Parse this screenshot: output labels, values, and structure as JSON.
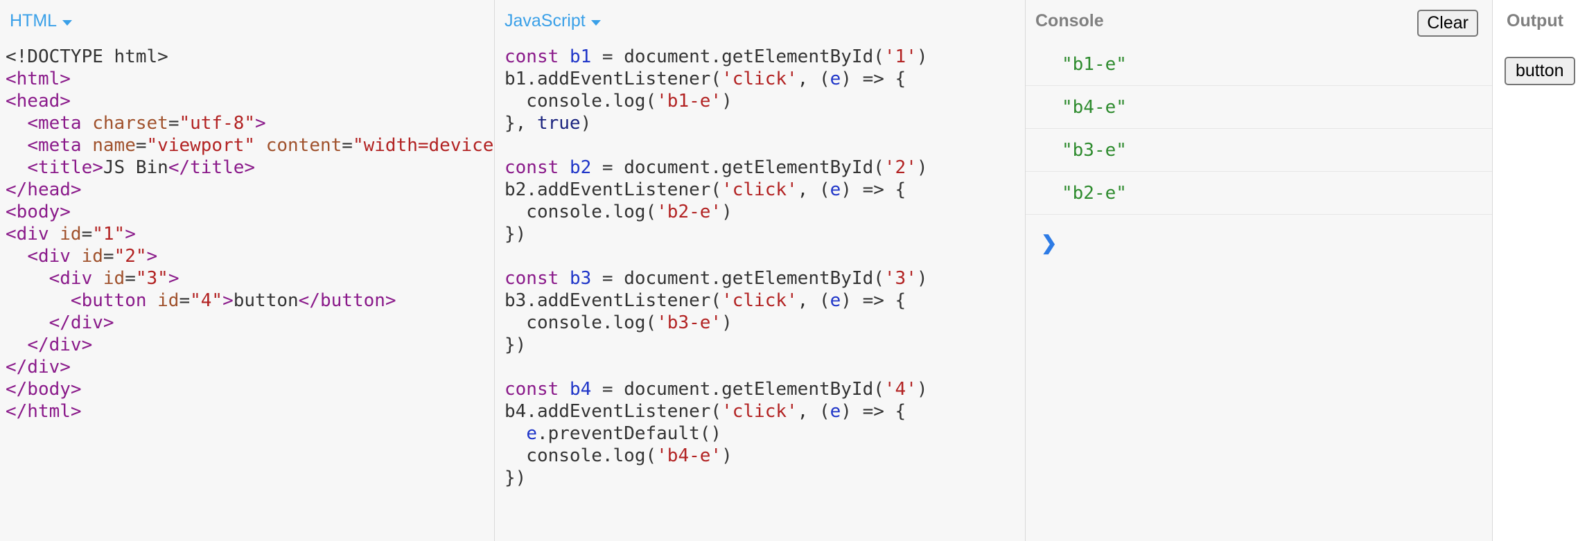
{
  "panels": {
    "html": {
      "label": "HTML"
    },
    "javascript": {
      "label": "JavaScript"
    },
    "console": {
      "label": "Console",
      "clear_label": "Clear"
    },
    "output": {
      "label": "Output",
      "button_label": "button"
    }
  },
  "html_code": [
    [
      [
        "t",
        "<!DOCTYPE html>"
      ]
    ],
    [
      [
        "p",
        "<html>"
      ]
    ],
    [
      [
        "p",
        "<head>"
      ]
    ],
    [
      [
        "t",
        "  "
      ],
      [
        "p",
        "<meta "
      ],
      [
        "o",
        "charset"
      ],
      [
        "t",
        "="
      ],
      [
        "r",
        "\"utf-8\""
      ],
      [
        "p",
        ">"
      ]
    ],
    [
      [
        "t",
        "  "
      ],
      [
        "p",
        "<meta "
      ],
      [
        "o",
        "name"
      ],
      [
        "t",
        "="
      ],
      [
        "r",
        "\"viewport\""
      ],
      [
        "t",
        " "
      ],
      [
        "o",
        "content"
      ],
      [
        "t",
        "="
      ],
      [
        "r",
        "\"width=device-width\""
      ]
    ],
    [
      [
        "t",
        "  "
      ],
      [
        "p",
        "<title>"
      ],
      [
        "t",
        "JS Bin"
      ],
      [
        "p",
        "</title>"
      ]
    ],
    [
      [
        "p",
        "</head>"
      ]
    ],
    [
      [
        "p",
        "<body>"
      ]
    ],
    [
      [
        "p",
        "<div "
      ],
      [
        "o",
        "id"
      ],
      [
        "t",
        "="
      ],
      [
        "r",
        "\"1\""
      ],
      [
        "p",
        ">"
      ]
    ],
    [
      [
        "t",
        "  "
      ],
      [
        "p",
        "<div "
      ],
      [
        "o",
        "id"
      ],
      [
        "t",
        "="
      ],
      [
        "r",
        "\"2\""
      ],
      [
        "p",
        ">"
      ]
    ],
    [
      [
        "t",
        "    "
      ],
      [
        "p",
        "<div "
      ],
      [
        "o",
        "id"
      ],
      [
        "t",
        "="
      ],
      [
        "r",
        "\"3\""
      ],
      [
        "p",
        ">"
      ]
    ],
    [
      [
        "t",
        "      "
      ],
      [
        "p",
        "<button "
      ],
      [
        "o",
        "id"
      ],
      [
        "t",
        "="
      ],
      [
        "r",
        "\"4\""
      ],
      [
        "p",
        ">"
      ],
      [
        "t",
        "button"
      ],
      [
        "p",
        "</button>"
      ]
    ],
    [
      [
        "t",
        "    "
      ],
      [
        "p",
        "</div>"
      ]
    ],
    [
      [
        "t",
        "  "
      ],
      [
        "p",
        "</div>"
      ]
    ],
    [
      [
        "p",
        "</div>"
      ]
    ],
    [
      [
        "p",
        "</body>"
      ]
    ],
    [
      [
        "p",
        "</html>"
      ]
    ]
  ],
  "js_code": [
    [
      [
        "p",
        "const"
      ],
      [
        "t",
        " "
      ],
      [
        "b",
        "b1"
      ],
      [
        "t",
        " = document.getElementById("
      ],
      [
        "r",
        "'1'"
      ],
      [
        "t",
        ")"
      ]
    ],
    [
      [
        "t",
        "b1.addEventListener("
      ],
      [
        "r",
        "'click'"
      ],
      [
        "t",
        ", ("
      ],
      [
        "b",
        "e"
      ],
      [
        "t",
        ") => {"
      ]
    ],
    [
      [
        "t",
        "  console.log("
      ],
      [
        "r",
        "'b1-e'"
      ],
      [
        "t",
        ")"
      ]
    ],
    [
      [
        "t",
        "}, "
      ],
      [
        "n",
        "true"
      ],
      [
        "t",
        ")"
      ]
    ],
    [
      [
        "t",
        ""
      ]
    ],
    [
      [
        "p",
        "const"
      ],
      [
        "t",
        " "
      ],
      [
        "b",
        "b2"
      ],
      [
        "t",
        " = document.getElementById("
      ],
      [
        "r",
        "'2'"
      ],
      [
        "t",
        ")"
      ]
    ],
    [
      [
        "t",
        "b2.addEventListener("
      ],
      [
        "r",
        "'click'"
      ],
      [
        "t",
        ", ("
      ],
      [
        "b",
        "e"
      ],
      [
        "t",
        ") => {"
      ]
    ],
    [
      [
        "t",
        "  console.log("
      ],
      [
        "r",
        "'b2-e'"
      ],
      [
        "t",
        ")"
      ]
    ],
    [
      [
        "t",
        "})"
      ]
    ],
    [
      [
        "t",
        ""
      ]
    ],
    [
      [
        "p",
        "const"
      ],
      [
        "t",
        " "
      ],
      [
        "b",
        "b3"
      ],
      [
        "t",
        " = document.getElementById("
      ],
      [
        "r",
        "'3'"
      ],
      [
        "t",
        ")"
      ]
    ],
    [
      [
        "t",
        "b3.addEventListener("
      ],
      [
        "r",
        "'click'"
      ],
      [
        "t",
        ", ("
      ],
      [
        "b",
        "e"
      ],
      [
        "t",
        ") => {"
      ]
    ],
    [
      [
        "t",
        "  console.log("
      ],
      [
        "r",
        "'b3-e'"
      ],
      [
        "t",
        ")"
      ]
    ],
    [
      [
        "t",
        "})"
      ]
    ],
    [
      [
        "t",
        ""
      ]
    ],
    [
      [
        "p",
        "const"
      ],
      [
        "t",
        " "
      ],
      [
        "b",
        "b4"
      ],
      [
        "t",
        " = document.getElementById("
      ],
      [
        "r",
        "'4'"
      ],
      [
        "t",
        ")"
      ]
    ],
    [
      [
        "t",
        "b4.addEventListener("
      ],
      [
        "r",
        "'click'"
      ],
      [
        "t",
        ", ("
      ],
      [
        "b",
        "e"
      ],
      [
        "t",
        ") => {"
      ]
    ],
    [
      [
        "t",
        "  "
      ],
      [
        "b",
        "e"
      ],
      [
        "t",
        ".preventDefault()"
      ]
    ],
    [
      [
        "t",
        "  console.log("
      ],
      [
        "r",
        "'b4-e'"
      ],
      [
        "t",
        ")"
      ]
    ],
    [
      [
        "t",
        "})"
      ]
    ]
  ],
  "console_logs": [
    "\"b1-e\"",
    "\"b4-e\"",
    "\"b3-e\"",
    "\"b2-e\""
  ],
  "console_prompt": "❯",
  "colors": {
    "t": "#333333",
    "p": "#8a1a8a",
    "o": "#a0522d",
    "r": "#b22222",
    "b": "#1f35c8",
    "n": "#1a237e",
    "accent": "#3aa0e8",
    "log": "#2e8b2e",
    "prompt": "#2d7be5"
  },
  "icons": {
    "caret": "chevron-down-icon",
    "prompt": "chevron-right-icon"
  }
}
